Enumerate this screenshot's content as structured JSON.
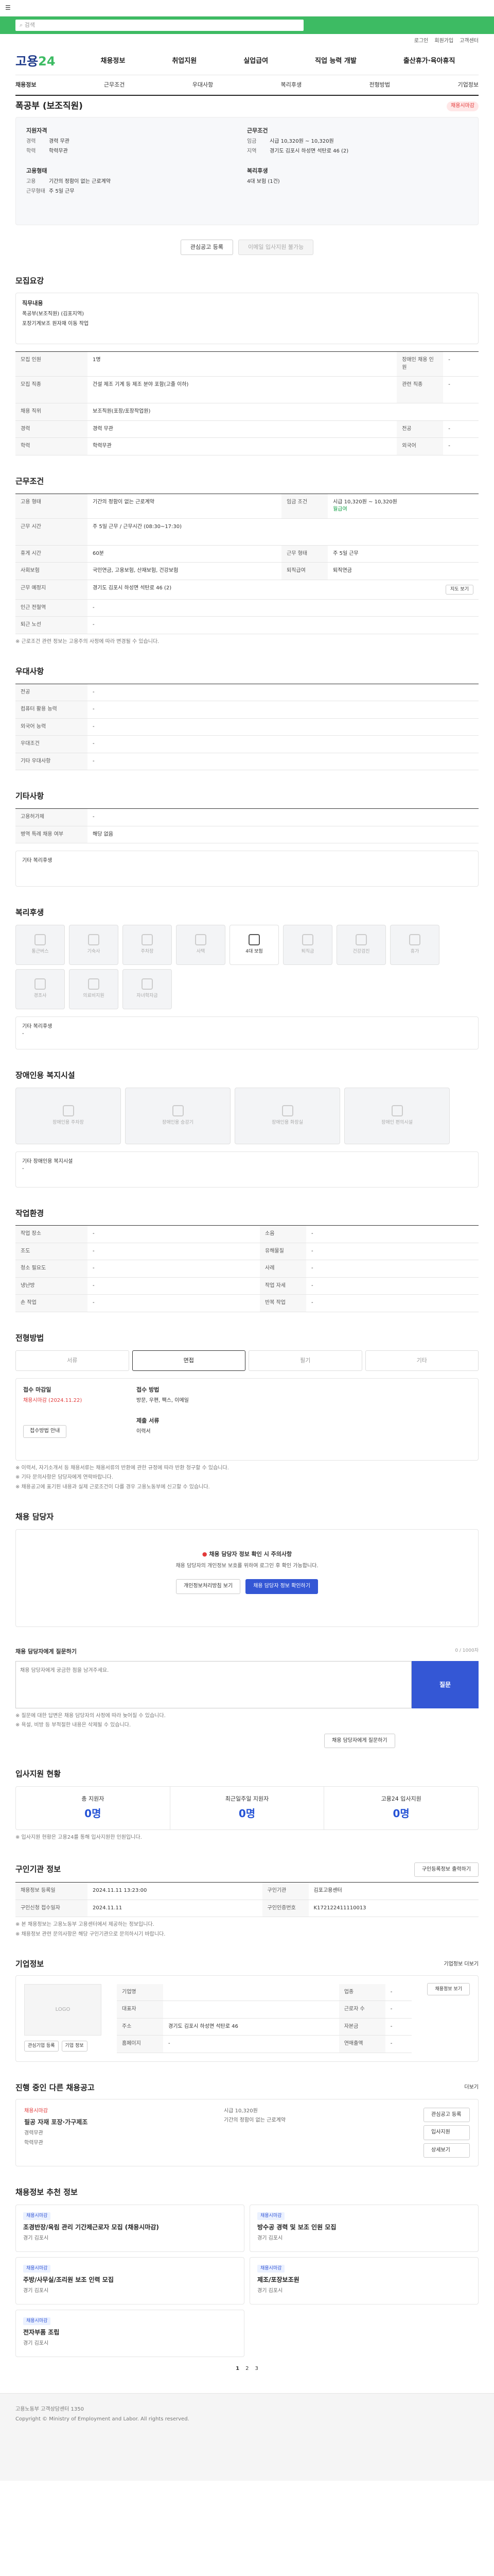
{
  "topbar": {
    "menu_icon": "menu-icon"
  },
  "search": {
    "placeholder": "검색"
  },
  "util": [
    "로그인",
    "회원가입",
    "고객센터"
  ],
  "logo": {
    "main": "고용",
    "accent": "24"
  },
  "gnb": [
    "채용정보",
    "취업지원",
    "실업급여",
    "직업 능력 개발",
    "출산휴가·육아휴직"
  ],
  "lnb": [
    "채용정보",
    "근무조건",
    "우대사항",
    "복리후생",
    "전형방법",
    "기업정보"
  ],
  "title": "폭공부 (보조직원)",
  "badge": "채용시마감",
  "summary": {
    "left_label": "지원자격",
    "left": [
      [
        "경력",
        "경력 무관"
      ],
      [
        "학력",
        "학력무관"
      ]
    ],
    "right_label": "근무조건",
    "right": [
      [
        "임금",
        "시급 10,320원 ~ 10,320원"
      ],
      [
        "지역",
        "경기도 김포시 하성면 석탄로 46 (2)"
      ]
    ],
    "left2_label": "고용형태",
    "left2": [
      [
        "고용",
        "기간의 정함이 없는 근로계약"
      ],
      [
        "근무형태",
        "주 5일 근무"
      ]
    ],
    "right2_label": "복리후생",
    "right2": [
      [
        "",
        "4대 보험 (1건)"
      ]
    ],
    "btn1": "관심공고 등록",
    "btn2": "이메일 입사지원 불가능"
  },
  "qual": {
    "title": "모집요강",
    "job_label": "직무내용",
    "job_text1": "폭공부(보조직원) (김포지역)",
    "job_text2": "포장기계보조 원자재 이동 작업",
    "rows": [
      [
        "모집 인원",
        "1명",
        "장애인 채용 인원",
        "-"
      ],
      [
        "모집 직종",
        "보조직원(포장/포장작업원)",
        "",
        ""
      ],
      [
        "경력",
        "경력 무관",
        "전공",
        "-"
      ],
      [
        "학력",
        "학력무관",
        "외국어",
        "-"
      ],
      [
        "자격면허",
        "",
        "",
        ""
      ]
    ],
    "job_kind": "건설 제조 기계 등 제조 분야 포함(고졸 이하)"
  },
  "cond": {
    "title": "근무조건",
    "rows": [
      [
        "고용 형태",
        "기간의 정함이 없는 근로계약",
        "임금 조건",
        "시급 10,320원 ~ 10,320원"
      ],
      [
        "근무 시간",
        "주 5일 근무 / 근무시간 (08:30~17:30)",
        "",
        ""
      ],
      [
        "휴게 시간",
        "60분",
        "근무 형태",
        "주 5일 근무"
      ],
      [
        "사회보험",
        "국민연금, 고용보험, 산재보험, 건강보험",
        "퇴직급여",
        "퇴직연금"
      ],
      [
        "근무 예정지",
        "경기도 김포시 하성면 석탄로 46 (2)",
        "",
        ""
      ],
      [
        "인근 전철역",
        "-",
        "",
        ""
      ],
      [
        "퇴근 노선",
        "-",
        "",
        ""
      ]
    ],
    "map_btn": "지도 보기",
    "wage_note": "월급여",
    "note": "※ 근로조건 관련 정보는 고용주의 사정에 따라 변경될 수 있습니다."
  },
  "pref": {
    "title": "우대사항",
    "rows": [
      [
        "전공",
        "-"
      ],
      [
        "컴퓨터 활용 능력",
        "-"
      ],
      [
        "외국어 능력",
        "-"
      ],
      [
        "우대조건",
        "-"
      ],
      [
        "기타 우대사항",
        "-"
      ]
    ]
  },
  "etc": {
    "title": "기타사항",
    "rows": [
      [
        "고용허가제",
        "-"
      ],
      [
        "병역 특례 채용 여부",
        "해당 없음"
      ]
    ],
    "extra": "기타 복리후생"
  },
  "welfare": {
    "title": "복리후생",
    "tiles": [
      [
        "통근버스",
        false
      ],
      [
        "기숙사",
        false
      ],
      [
        "주차장",
        false
      ],
      [
        "사택",
        false
      ],
      [
        "4대 보험",
        true
      ],
      [
        "퇴직금",
        false
      ],
      [
        "건강검진",
        false
      ],
      [
        "휴가",
        false
      ],
      [
        "경조사",
        false
      ],
      [
        "의료비지원",
        false
      ],
      [
        "자녀학자금",
        false
      ]
    ],
    "extra_label": "기타 복리후생",
    "extra_val": "-"
  },
  "disab": {
    "title": "장애인용 복지시설",
    "tiles": [
      "장애인용 주차장",
      "장애인용 승강기",
      "장애인용 화장실",
      "장애인 편의시설"
    ],
    "extra_label": "기타 장애인용 복지시설",
    "extra_val": "-"
  },
  "workenv": {
    "title": "작업환경",
    "rows": [
      [
        "작업 장소",
        "-",
        "소음",
        "-"
      ],
      [
        "조도",
        "-",
        "유해물질",
        "-"
      ],
      [
        "청소 필요도",
        "-",
        "",
        ""
      ],
      [
        "냉난방",
        "-",
        "",
        ""
      ],
      [
        "손 작업",
        "-",
        "반복 작업",
        "-"
      ]
    ]
  },
  "process": {
    "title": "전형방법",
    "steps": [
      "서류",
      "면접",
      "필기",
      "기타"
    ],
    "period_label": "접수 마감일",
    "period_value": "채용시마감 (2024.11.22)",
    "method_label": "접수 방법",
    "method_value": "방문, 우편, 팩스, 이메일",
    "doc_label": "제출 서류",
    "doc_value": "이력서",
    "btn": "접수방법 안내",
    "notes": [
      "※ 이력서, 자기소개서 등 채용서류는 채용서류의 반환에 관한 규정에 따라 반환 청구할 수 있습니다.",
      "※ 기타 문의사항은 담당자에게 연락바랍니다.",
      "※ 채용공고에 표기된 내용과 실제 근로조건이 다를 경우 고용노동부에 신고할 수 있습니다."
    ]
  },
  "contact": {
    "title": "채용 담당자",
    "box_title": "채용 담당자 정보 확인 시 주의사항",
    "box_text": "채용 담당자의 개인정보 보호를 위하여 로그인 후 확인 가능합니다.",
    "btn1": "개인정보처리방침 보기",
    "btn2": "채용 담당자 정보 확인하기"
  },
  "qna": {
    "title": "채용 담당자에게 질문하기",
    "placeholder": "채용 담당자에게 궁금한 점을 남겨주세요.",
    "counter": "0 / 1000자",
    "send": "질문",
    "btn": "채용 담당자에게 질문하기",
    "notes": [
      "※ 질문에 대한 답변은 채용 담당자의 사정에 따라 늦어질 수 있습니다.",
      "※ 욕설, 비방 등 부적절한 내용은 삭제될 수 있습니다."
    ]
  },
  "applicants": {
    "title": "입사지원 현황",
    "cols": [
      [
        "총 지원자",
        "0명"
      ],
      [
        "최근일주일 지원자",
        "0명"
      ],
      [
        "고용24 입사지원",
        "0명"
      ]
    ],
    "note": "※ 입사지원 현황은 고용24를 통해 입사지원한 인원입니다."
  },
  "meta": {
    "title": "구인기관 정보",
    "print": "구인등록정보 출력하기",
    "rows": [
      [
        "채용정보 등록일",
        "2024.11.11 13:23:00",
        "구인기관",
        "김포고용센터"
      ],
      [
        "구인신청 접수일자",
        "2024.11.11",
        "구인인증번호",
        "K172122411110013"
      ]
    ],
    "notes": [
      "※ 본 채용정보는 고용노동부 고용센터에서 제공하는 정보입니다.",
      "※ 채용정보 관련 문의사항은 해당 구인기관으로 문의하시기 바랍니다."
    ]
  },
  "company": {
    "title": "기업정보",
    "more": "기업정보 더보기",
    "logo": "LOGO",
    "rows": [
      [
        "기업명",
        "",
        "업종",
        "-"
      ],
      [
        "대표자",
        "",
        "근로자 수",
        "-"
      ],
      [
        "주소",
        "경기도 김포시 하성면 석탄로 46",
        "자본금",
        "-"
      ],
      [
        "홈페이지",
        "-",
        "연매출액",
        "-"
      ]
    ],
    "btn1": "관심기업 등록",
    "btn2": "기업 정보",
    "btn3": "채용정보 보기"
  },
  "related": {
    "title": "진행 중인 다른 채용공고",
    "more": "더보기",
    "tag": "채용시마감",
    "job": "필공 자재 포장·가구제조",
    "details": [
      "경력무관",
      "학력무관",
      "시급 10,320원",
      "기간의 정함이 없는 근로계약"
    ],
    "btn1": "관심공고 등록",
    "btn2": "입사지원",
    "btn3": "상세보기"
  },
  "recommend": {
    "title": "채용정보 추천 정보",
    "cards": [
      {
        "tag": "채용시마감",
        "title": "조경반장/육림 관리 기간제근로자 모집 (채용시마감)",
        "meta": "경기 김포시"
      },
      {
        "tag": "채용시마감",
        "title": "방수공 경력 및 보조 인원 모집",
        "meta": "경기 김포시"
      },
      {
        "tag": "채용시마감",
        "title": "주방/사무실/조리원 보조 인력 모집",
        "meta": "경기 김포시"
      },
      {
        "tag": "채용시마감",
        "title": "제조/포장보조원",
        "meta": "경기 김포시"
      },
      {
        "tag": "채용시마감",
        "title": "전자부품 조립",
        "meta": "경기 김포시"
      }
    ],
    "pager": [
      "1",
      "2",
      "3"
    ]
  },
  "footer": {
    "lines": [
      "고용노동부 고객상담센터 1350",
      "Copyright © Ministry of Employment and Labor. All rights reserved."
    ]
  }
}
